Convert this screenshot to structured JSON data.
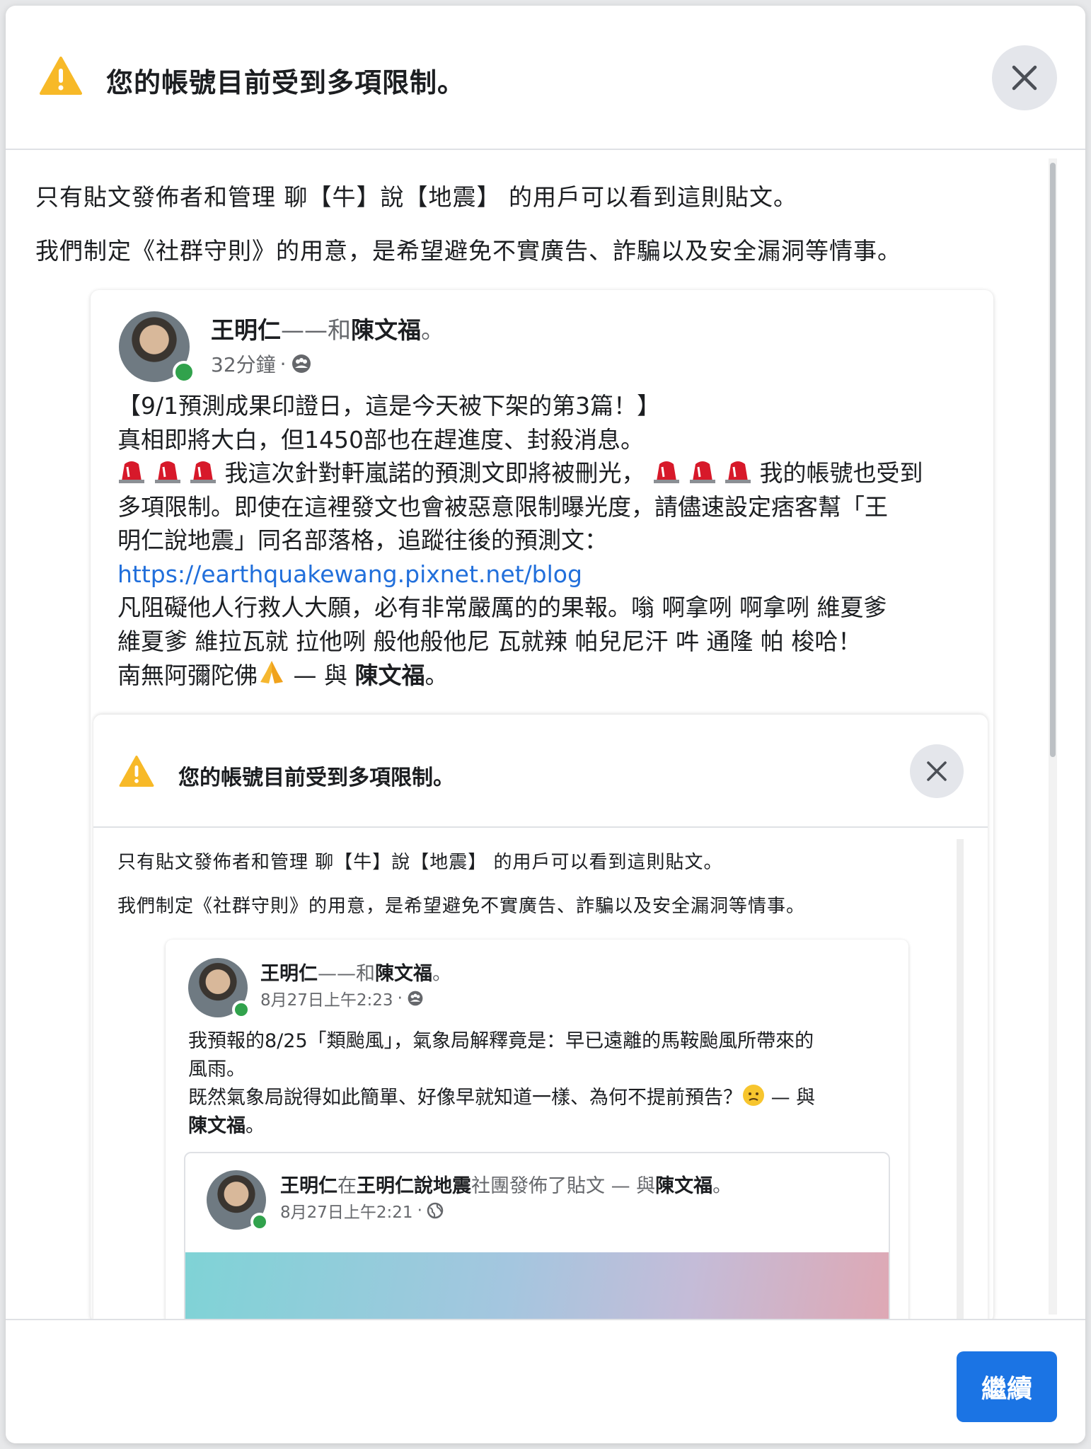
{
  "modal": {
    "title": "您的帳號目前受到多項限制。",
    "notice_line1": "只有貼文發佈者和管理 聊【牛】說【地震】 的用戶可以看到這則貼文。",
    "notice_line2": "我們制定《社群守則》的用意，是希望避免不實廣告、詐騙以及安全漏洞等情事。",
    "continue_label": "繼續"
  },
  "post": {
    "author": "王明仁",
    "with_text": "——和",
    "tagged": "陳文福",
    "period": "。",
    "time": "32分鐘",
    "audience_icon": "group-icon",
    "lines": [
      "【9/1預測成果印證日，這是今天被下架的第3篇！】",
      "真相即將大白，但1450部也在趕進度、封殺消息。",
      "我這次針對軒嵐諾的預測文即將被刪光，",
      "我的帳號也受到",
      "多項限制。即使在這裡發文也會被惡意限制曝光度，請儘速設定痞客幫「王",
      "明仁說地震」同名部落格，追蹤往後的預測文：",
      "https://earthquakewang.pixnet.net/blog",
      "凡阻礙他人行救人大願，必有非常嚴厲的的果報。嗡 啊拿咧 啊拿咧  維夏爹",
      "維夏爹 維拉瓦就 拉他咧 般他般他尼 瓦就辣 帕兒尼汗 吽 通隆 帕 梭哈！",
      "南無阿彌陀佛",
      "— 與",
      "陳文福",
      "。"
    ]
  },
  "inner": {
    "title": "您的帳號目前受到多項限制。",
    "notice_line1": "只有貼文發佈者和管理 聊【牛】說【地震】 的用戶可以看到這則貼文。",
    "notice_line2": "我們制定《社群守則》的用意，是希望避免不實廣告、詐騙以及安全漏洞等情事。",
    "post": {
      "author": "王明仁",
      "with_text": "——和",
      "tagged": "陳文福",
      "period": "。",
      "time": "8月27日上午2:23",
      "lines": [
        "我預報的8/25「類颱風」，氣象局解釋竟是：早已遠離的馬鞍颱風所帶來的",
        "風雨。",
        "既然氣象局說得如此簡單、好像早就知道一樣、為何不提前預告？",
        "— 與",
        "陳文福",
        "。"
      ]
    },
    "shared": {
      "author": "王明仁",
      "in_text": "在",
      "group": "王明仁說地震",
      "posted_text": "社團發佈了貼文 — 與",
      "tagged": "陳文福",
      "period": "。",
      "time": "8月27日上午2:21",
      "audience_icon": "globe-icon"
    }
  },
  "colors": {
    "primary": "#1b74e4",
    "link": "#216fdb",
    "warning": "#f7b928",
    "online": "#31a24c",
    "muted": "#65676b"
  }
}
